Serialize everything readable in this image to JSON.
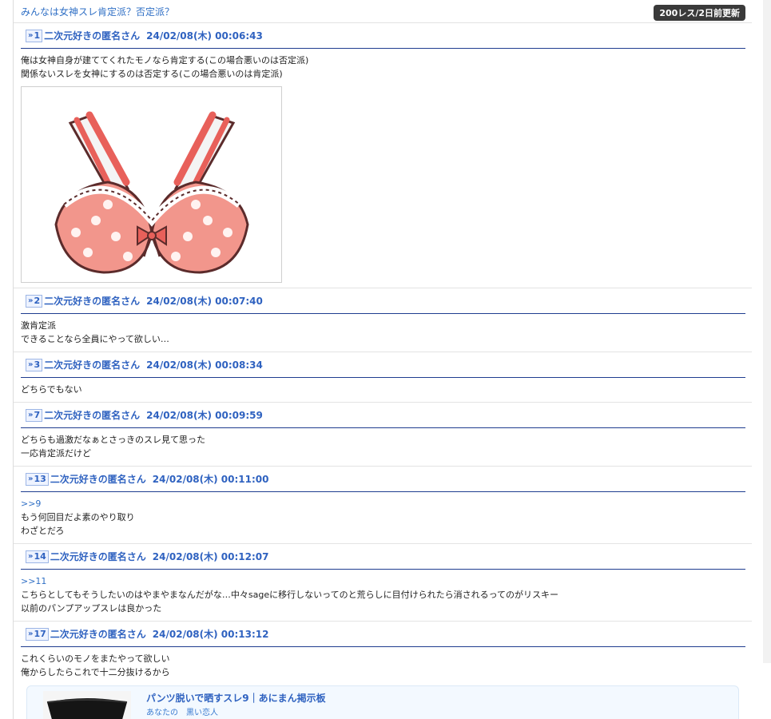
{
  "thread": {
    "title": "みんなは女神スレ肯定派？否定派？",
    "badge": "200レス/2日前更新"
  },
  "posts": [
    {
      "num": "1",
      "name": "二次元好きの匿名さん",
      "date": "24/02/08(木) 00:06:43",
      "lines": [
        "俺は女神自身が建ててくれたモノなら肯定する(この場合悪いのは否定派)",
        "関係ないスレを女神にするのは否定する(この場合悪いのは肯定派)"
      ]
    },
    {
      "num": "2",
      "name": "二次元好きの匿名さん",
      "date": "24/02/08(木) 00:07:40",
      "lines": [
        "激肯定派",
        "できることなら全員にやって欲しい…"
      ]
    },
    {
      "num": "3",
      "name": "二次元好きの匿名さん",
      "date": "24/02/08(木) 00:08:34",
      "lines": [
        "どちらでもない"
      ]
    },
    {
      "num": "7",
      "name": "二次元好きの匿名さん",
      "date": "24/02/08(木) 00:09:59",
      "lines": [
        "どちらも過激だなぁとさっきのスレ見て思った",
        "一応肯定派だけど"
      ]
    },
    {
      "num": "13",
      "name": "二次元好きの匿名さん",
      "date": "24/02/08(木) 00:11:00",
      "anchor": ">>9",
      "lines": [
        "もう何回目だよ素のやり取り",
        "わざとだろ"
      ]
    },
    {
      "num": "14",
      "name": "二次元好きの匿名さん",
      "date": "24/02/08(木) 00:12:07",
      "anchor": ">>11",
      "lines": [
        "こちらとしてもそうしたいのはやまやまなんだがな…中々sageに移行しないってのと荒らしに目付けられたら消されるってのがリスキー",
        "以前のパンプアップスレは良かった"
      ]
    },
    {
      "num": "17",
      "name": "二次元好きの匿名さん",
      "date": "24/02/08(木) 00:13:12",
      "lines": [
        "これくらいのモノをまたやって欲しい",
        "俺からしたらこれで十二分抜けるから"
      ]
    }
  ],
  "related": {
    "title": "パンツ脱いで晒すスレ9｜あにまん掲示板",
    "sub": "あなたの　黒い恋人"
  },
  "icons": {
    "resnum_arrow": "double-chevron-right-icon"
  },
  "colors": {
    "link": "#2f62c0",
    "header_rule": "#1f3d8f",
    "badge_bg": "#3a3a3a"
  }
}
